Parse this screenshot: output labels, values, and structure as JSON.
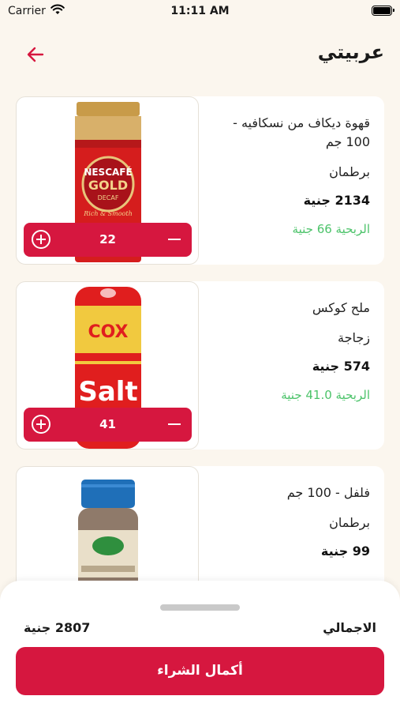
{
  "status_bar": {
    "carrier": "Carrier",
    "time": "11:11 AM"
  },
  "header": {
    "title": "عربيتي",
    "back_icon": "arrow-left-icon"
  },
  "colors": {
    "accent": "#d6173f",
    "profit": "#4cc36a",
    "background": "#fbf6ee"
  },
  "products": [
    {
      "name": "قهوة ديكاف من نسكافيه - 100 جم",
      "pack": "برطمان",
      "price": "2134 جنية",
      "profit": "الربحية 66 جنية",
      "qty": "22",
      "image": "nescafe-gold-jar"
    },
    {
      "name": "ملح كوكس",
      "pack": "زجاجة",
      "price": "574 جنية",
      "profit": "الربحية 41.0 جنية",
      "qty": "41",
      "image": "cox-salt-bottle"
    },
    {
      "name": "فلفل - 100 جم",
      "pack": "برطمان",
      "price": "99 جنية",
      "image": "pepper-jar"
    }
  ],
  "summary": {
    "total_label": "الاجمالي",
    "total_value": "2807 جنية",
    "checkout_label": "أكمال الشراء"
  }
}
